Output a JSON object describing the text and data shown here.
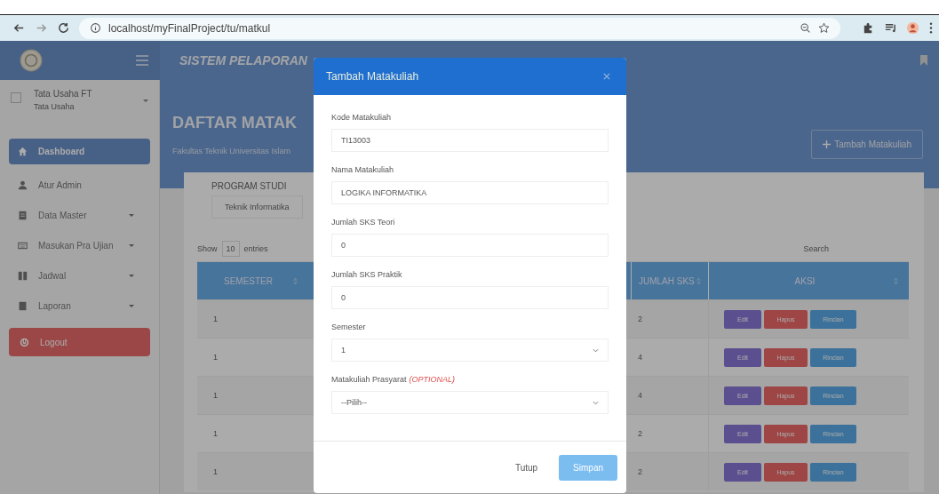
{
  "browser": {
    "url": "localhost/myFinalProject/tu/matkul"
  },
  "app_header": {
    "title": "SISTEM PELAPORAN"
  },
  "sidebar": {
    "user_name": "Tata Usaha FT",
    "user_role": "Tata Usaha",
    "items": [
      {
        "label": "Dashboard",
        "kind": "home",
        "selected": true,
        "expandable": false
      },
      {
        "label": "Atur Admin",
        "kind": "user",
        "selected": false,
        "expandable": false
      },
      {
        "label": "Data Master",
        "kind": "list",
        "selected": false,
        "expandable": true
      },
      {
        "label": "Masukan Pra Ujian",
        "kind": "keyboard",
        "selected": false,
        "expandable": true
      },
      {
        "label": "Jadwal",
        "kind": "columns",
        "selected": false,
        "expandable": true
      },
      {
        "label": "Laporan",
        "kind": "book",
        "selected": false,
        "expandable": true
      }
    ],
    "logout": "Logout"
  },
  "page": {
    "heading": "DAFTAR MATAK",
    "subtitle": "Fakultas Teknik Universitas Islam",
    "add_button": "Tambah Matakuliah"
  },
  "filter": {
    "label": "PROGRAM STUDI",
    "value": "Teknik Informatika"
  },
  "table": {
    "show_label": "Show",
    "page_size": "10",
    "entries_label": "entries",
    "search_label": "Search",
    "columns": [
      "SEMESTER",
      "JUMLAH SKS",
      "AKSI"
    ],
    "rows": [
      {
        "semester": "1",
        "sks": "2",
        "actions": [
          {
            "label": "Edit",
            "kind": "edit"
          },
          {
            "label": "Hapus",
            "kind": "delete"
          },
          {
            "label": "Rincian",
            "kind": "detail"
          }
        ]
      },
      {
        "semester": "1",
        "sks": "4",
        "actions": [
          {
            "label": "Edit",
            "kind": "edit"
          },
          {
            "label": "Hapus",
            "kind": "delete"
          },
          {
            "label": "Rincian",
            "kind": "detail"
          }
        ]
      },
      {
        "semester": "1",
        "sks": "4",
        "actions": [
          {
            "label": "Edit",
            "kind": "edit"
          },
          {
            "label": "Hapus",
            "kind": "delete"
          },
          {
            "label": "Rincian",
            "kind": "detail"
          }
        ]
      },
      {
        "semester": "1",
        "sks": "2",
        "actions": [
          {
            "label": "Edit",
            "kind": "edit"
          },
          {
            "label": "Hapus",
            "kind": "delete"
          },
          {
            "label": "Rincian",
            "kind": "detail"
          }
        ]
      },
      {
        "semester": "1",
        "sks": "2",
        "actions": [
          {
            "label": "Edit",
            "kind": "edit"
          },
          {
            "label": "Hapus",
            "kind": "delete"
          },
          {
            "label": "Rincian",
            "kind": "detail"
          }
        ]
      }
    ]
  },
  "modal": {
    "title": "Tambah Matakuliah",
    "fields": [
      {
        "label": "Kode Matakuliah",
        "value": "TI13003",
        "kind": "input"
      },
      {
        "label": "Nama Matakuliah",
        "value": "LOGIKA INFORMATIKA",
        "kind": "input"
      },
      {
        "label": "Jumlah SKS Teori",
        "value": "0",
        "kind": "input"
      },
      {
        "label": "Jumlah SKS Praktik",
        "value": "0",
        "kind": "input"
      },
      {
        "label": "Semester",
        "value": "1",
        "kind": "select"
      },
      {
        "label": "Matakuliah Prasyarat",
        "note": "(OPTIONAL)",
        "value": "--Pilih--",
        "kind": "select"
      }
    ],
    "buttons": [
      {
        "label": "Tutup",
        "kind": "secondary"
      },
      {
        "label": "Simpan",
        "kind": "primary"
      }
    ]
  }
}
